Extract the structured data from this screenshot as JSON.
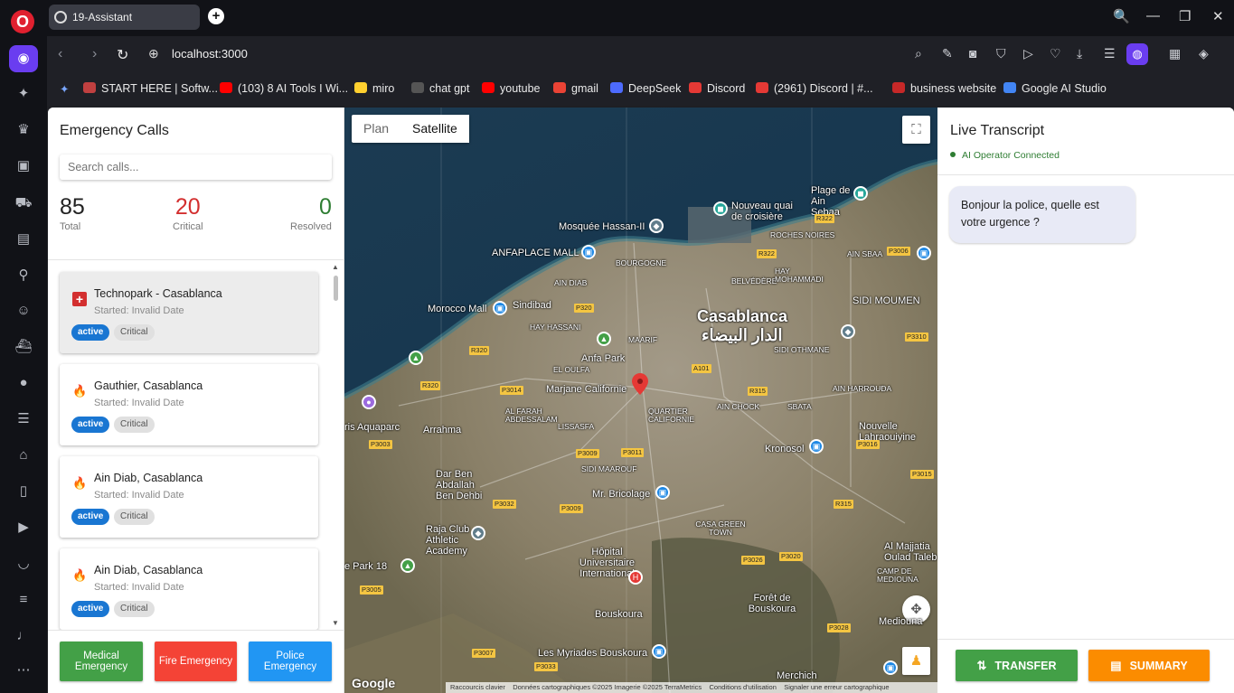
{
  "browser": {
    "tab_title": "19-Assistant",
    "new_tab": "+",
    "url": "localhost:3000",
    "window_controls": [
      "🔍",
      "—",
      "❐",
      "✕"
    ]
  },
  "bookmarks": [
    {
      "label": "START HERE | Softw...",
      "color": "#c04040"
    },
    {
      "label": "(103) 8 AI Tools I Wi...",
      "color": "#ff0000"
    },
    {
      "label": "miro",
      "color": "#ffd02f"
    },
    {
      "label": "chat gpt",
      "color": "#555555"
    },
    {
      "label": "youtube",
      "color": "#ff0000"
    },
    {
      "label": "gmail",
      "color": "#ea4335"
    },
    {
      "label": "DeepSeek",
      "color": "#4d6bfe"
    },
    {
      "label": "Discord",
      "color": "#e53935"
    },
    {
      "label": "(2961) Discord | #...",
      "color": "#e53935"
    },
    {
      "label": "business website",
      "color": "#c62828"
    },
    {
      "label": "Google AI Studio",
      "color": "#4285f4"
    }
  ],
  "left_panel": {
    "title": "Emergency Calls",
    "search_placeholder": "Search calls...",
    "stats": {
      "total": {
        "value": "85",
        "label": "Total"
      },
      "critical": {
        "value": "20",
        "label": "Critical"
      },
      "resolved": {
        "value": "0",
        "label": "Resolved"
      }
    },
    "calls": [
      {
        "type": "medical",
        "title": "Technopark - Casablanca",
        "started": "Started: Invalid Date",
        "status": "active",
        "severity": "Critical",
        "selected": true
      },
      {
        "type": "fire",
        "title": "Gauthier, Casablanca",
        "started": "Started: Invalid Date",
        "status": "active",
        "severity": "Critical",
        "selected": false
      },
      {
        "type": "fire",
        "title": "Ain Diab, Casablanca",
        "started": "Started: Invalid Date",
        "status": "active",
        "severity": "Critical",
        "selected": false
      },
      {
        "type": "fire",
        "title": "Ain Diab, Casablanca",
        "started": "Started: Invalid Date",
        "status": "active",
        "severity": "Critical",
        "selected": false
      }
    ],
    "buttons": {
      "medical": "Medical Emergency",
      "fire": "Fire Emergency",
      "police": "Police Emergency"
    }
  },
  "map": {
    "toggle": {
      "plan": "Plan",
      "satellite": "Satellite"
    },
    "labels": {
      "city": "Casablanca",
      "city_ar": "الدار البيضاء",
      "mosque": "Mosquée Hassan-II",
      "anfaplace": "ANFAPLACE MALL",
      "morocco_mall": "Morocco Mall",
      "sindibad": "Sindibad",
      "anfa_park": "Anfa Park",
      "marjane": "Marjane Californie",
      "nouveau_quai": "Nouveau quai de croisière",
      "plage": "Plage de Ain Sebaa",
      "sidi_moumen": "SIDI MOUMEN",
      "kronosol": "Kronosol",
      "nouvelle_lahraouiyine": "Nouvelle Lahraouiyine",
      "arrahma": "Arrahma",
      "dar_ben": "Dar Ben Abdallah Ben Dehbi",
      "mr_bricolage": "Mr. Bricolage",
      "raja": "Raja Club Athletic Academy",
      "hopital": "Hôpital Universitaire International",
      "bouskoura": "Bouskoura",
      "foret": "Forêt de Bouskoura",
      "myriades": "Les Myriades Bouskoura",
      "merchich": "Merchich",
      "al_majjatia": "Al Majjatia Oulad Taleb",
      "mediouna": "Mediouna",
      "aquaparc": "ris Aquaparc",
      "park18": "e Park 18",
      "maarif": "MAARIF",
      "quartier_cal": "QUARTIER CALIFORNIE",
      "bourgogne": "BOURGOGNE",
      "ain_diab": "AIN DIAB",
      "hay_hassani": "HAY HASSANI",
      "el_oulfa": "EL OULFA",
      "sidi_othmane": "SIDI OTHMANE",
      "ain_chock": "AIN CHOCK",
      "sbata": "SBATA",
      "sidi_maarouf": "SIDI MAAROUF",
      "lissasfa": "LISSASFA",
      "casa_green": "CASA GREEN TOWN",
      "belvedere": "BELVÉDÈRE",
      "hay_mohammadi": "HAY MOHAMMADI",
      "ain_sbaa": "AIN SBAA",
      "roches_noires": "ROCHES NOIRES",
      "ain_harrouda": "AIN HARROUDA",
      "al_farah": "AL FARAH ABDESSALAM",
      "camp": "CAMP DE MEDIOUNA",
      "google": "Google"
    },
    "attribution": [
      "Raccourcis clavier",
      "Données cartographiques ©2025 Imagerie ©2025 TerraMetrics",
      "Conditions d'utilisation",
      "Signaler une erreur cartographique"
    ]
  },
  "right_panel": {
    "title": "Live Transcript",
    "status": "AI Operator Connected",
    "message": "Bonjour la police, quelle est votre urgence ?",
    "transfer": "TRANSFER",
    "summary": "SUMMARY"
  },
  "colors": {
    "medical_btn": "#43a047",
    "fire_btn": "#f44336",
    "police_btn": "#2196f3",
    "transfer_btn": "#43a047",
    "summary_btn": "#fb8c00",
    "critical_red": "#d32f2f",
    "accent": "#6a3df0"
  }
}
